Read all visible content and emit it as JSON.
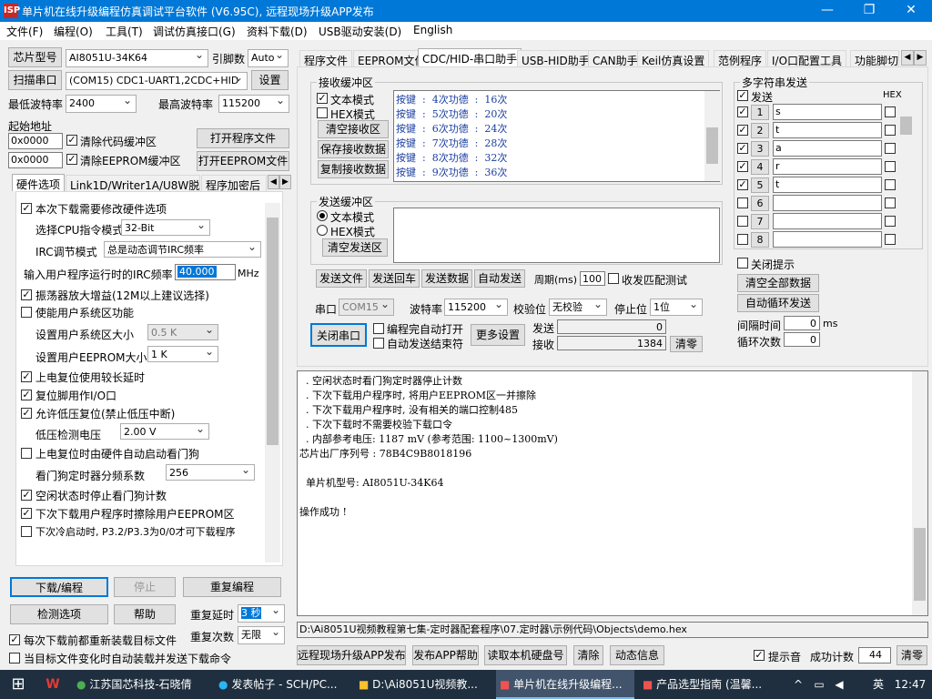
{
  "window": {
    "title": "单片机在线升级编程仿真调试平台软件 (V6.95C), 远程现场升级APP发布",
    "app_icon": "isp-icon",
    "min": "—",
    "max": "❐",
    "close": "✕"
  },
  "menu": [
    "文件(F)",
    "编程(O)",
    "工具(T)",
    "调试仿真接口(G)",
    "资料下载(D)",
    "USB驱动安装(D)",
    "English"
  ],
  "left": {
    "chip_btn": "芯片型号",
    "chip_value": "AI8051U-34K64",
    "pin_label": "引脚数",
    "pin_value": "Auto",
    "scan_btn": "扫描串口",
    "port_value": "(COM15) CDC1-UART1,2CDC+HID",
    "setup_btn": "设置",
    "min_baud_label": "最低波特率",
    "min_baud": "2400",
    "max_baud_label": "最高波特率",
    "max_baud": "115200",
    "start_addr_label": "起始地址",
    "addr1": "0x0000",
    "clear_code": "清除代码缓冲区",
    "open_prog": "打开程序文件",
    "addr2": "0x0000",
    "clear_eeprom": "清除EEPROM缓冲区",
    "open_eeprom": "打开EEPROM文件",
    "subtabs": [
      "硬件选项",
      "Link1D/Writer1A/U8W脱机",
      "程序加密后"
    ],
    "options": {
      "o1": "本次下载需要修改硬件选项",
      "cpu_label": "选择CPU指令模式",
      "cpu_value": "32-Bit",
      "irc_label": "IRC调节模式",
      "irc_value": "总是动态调节IRC频率",
      "freq_label": "输入用户程序运行时的IRC频率",
      "freq_value": "40.000",
      "freq_unit": "MHz",
      "o2": "振荡器放大增益(12M以上建议选择)",
      "o3": "使能用户系统区功能",
      "sys_label": "设置用户系统区大小",
      "sys_value": "0.5 K",
      "ee_label": "设置用户EEPROM大小",
      "ee_value": "1   K",
      "o4": "上电复位使用较长延时",
      "o5": "复位脚用作I/O口",
      "o6": "允许低压复位(禁止低压中断)",
      "lv_label": "低压检测电压",
      "lv_value": "2.00 V",
      "o7": "上电复位时由硬件自动启动看门狗",
      "wd_label": "看门狗定时器分频系数",
      "wd_value": "256",
      "o8": "空闲状态时停止看门狗计数",
      "o9": "下次下载用户程序时擦除用户EEPROM区",
      "o10": "下次冷启动时, P3.2/P3.3为0/0才可下载程序"
    },
    "download_btn": "下载/编程",
    "stop_btn": "停止",
    "reprog_btn": "重复编程",
    "detect_btn": "检测选项",
    "help_btn": "帮助",
    "delay_label": "重复延时",
    "delay_value": "3 秒",
    "count_label": "重复次数",
    "count_value": "无限",
    "reload_chk": "每次下载前都重新装载目标文件",
    "autoload_chk": "当目标文件变化时自动装载并发送下载命令"
  },
  "right_tabs": [
    "程序文件",
    "EEPROM文件",
    "CDC/HID-串口助手",
    "USB-HID助手",
    "CAN助手",
    "Keil仿真设置",
    "范例程序",
    "I/O口配置工具",
    "功能脚切"
  ],
  "recv": {
    "title": "接收缓冲区",
    "text_mode": "文本模式",
    "hex_mode": "HEX模式",
    "clear": "清空接收区",
    "save": "保存接收数据",
    "copy": "复制接收数据",
    "lines": [
      "按键  :  4次功德  :  16次",
      "按键  :  5次功德  :  20次",
      "按键  :  6次功德  :  24次",
      "按键  :  7次功德  :  28次",
      "按键  :  8次功德  :  32次",
      "按键  :  9次功德  :  36次"
    ]
  },
  "send": {
    "title": "发送缓冲区",
    "text_mode": "文本模式",
    "hex_mode": "HEX模式",
    "clear": "清空发送区",
    "send_file": "发送文件",
    "send_enter": "发送回车",
    "send_data": "发送数据",
    "auto_send": "自动发送",
    "period_label": "周期(ms)",
    "period": "100",
    "match": "收发匹配测试"
  },
  "serial": {
    "port_label": "串口",
    "port": "COM15",
    "baud_label": "波特率",
    "baud": "115200",
    "parity_label": "校验位",
    "parity": "无校验",
    "stop_label": "停止位",
    "stop": "1位",
    "close_btn": "关闭串口",
    "auto_open": "编程完自动打开",
    "auto_end": "自动发送结束符",
    "more": "更多设置",
    "send_label": "发送",
    "send_count": "0",
    "recv_label": "接收",
    "recv_count": "1384",
    "clear_btn": "清零"
  },
  "multi": {
    "title": "多字符串发送",
    "send_label": "发送",
    "hex_label": "HEX",
    "rows": [
      {
        "n": "1",
        "v": "s"
      },
      {
        "n": "2",
        "v": "t"
      },
      {
        "n": "3",
        "v": "a"
      },
      {
        "n": "4",
        "v": "r"
      },
      {
        "n": "5",
        "v": "t"
      },
      {
        "n": "6",
        "v": ""
      },
      {
        "n": "7",
        "v": ""
      },
      {
        "n": "8",
        "v": ""
      }
    ],
    "close_tip": "关闭提示",
    "clear_all": "清空全部数据",
    "auto_loop": "自动循环发送",
    "interval_label": "间隔时间",
    "interval": "0",
    "interval_unit": "ms",
    "loop_label": "循环次数",
    "loop": "0"
  },
  "log": [
    "  . 空闲状态时看门狗定时器停止计数",
    "  . 下次下载用户程序时, 将用户EEPROM区一并擦除",
    "  . 下次下载用户程序时, 没有相关的端口控制485",
    "  . 下次下载时不需要校验下载口令",
    "  . 内部参考电压: 1187 mV (参考范围: 1100~1300mV)",
    "芯片出厂序列号 : 78B4C9B8018196",
    "",
    "  单片机型号: AI8051U-34K64",
    "",
    "操作成功 !"
  ],
  "path": "D:\\Ai8051U视频教程第七集-定时器配套程序\\07.定时器\\示例代码\\Objects\\demo.hex",
  "bottom": {
    "remote": "远程现场升级APP发布",
    "app_help": "发布APP帮助",
    "read_disk": "读取本机硬盘号",
    "clear": "清除",
    "dynamic": "动态信息",
    "tone": "提示音",
    "success_label": "成功计数",
    "success": "44",
    "reset": "清零"
  },
  "taskbar": {
    "items": [
      "江苏国芯科技-石晓倩",
      "发表帖子 - SCH/PC...",
      "D:\\Ai8051U视频教...",
      "单片机在线升级编程...",
      "产品选型指南 (温馨..."
    ],
    "ime": "英",
    "time": "12:47",
    "tray_up": "^"
  }
}
